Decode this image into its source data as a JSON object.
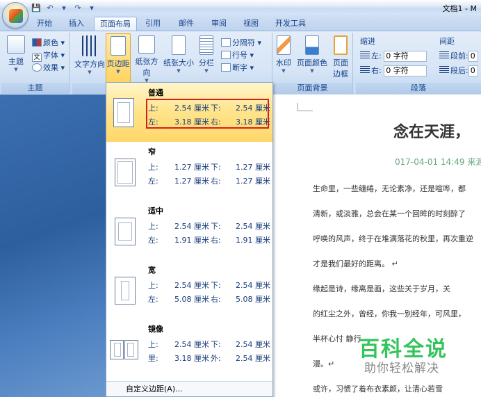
{
  "window": {
    "title": "文档1 - M"
  },
  "tabs": [
    "开始",
    "插入",
    "页面布局",
    "引用",
    "邮件",
    "审阅",
    "视图",
    "开发工具"
  ],
  "ribbon": {
    "theme_group": {
      "label": "主题",
      "theme_btn": "主题",
      "colors": "颜色",
      "fonts": "字体",
      "effects": "效果"
    },
    "page_setup": {
      "text_direction": "文字方向",
      "margins": "页边距",
      "orientation": "纸张方向",
      "size": "纸张大小",
      "columns": "分栏",
      "breaks": "分隔符",
      "line_numbers": "行号",
      "hyphenation": "断字"
    },
    "page_background": {
      "label": "页面背景",
      "watermark": "水印",
      "page_color": "页面颜色",
      "page_border_1": "页面",
      "page_border_2": "边框"
    },
    "paragraph": {
      "label": "段落",
      "indent": "缩进",
      "spacing": "间距",
      "left": "左:",
      "right": "右:",
      "left_val": "0 字符",
      "right_val": "0 字符",
      "before": "段前:",
      "after": "段后:",
      "before_val": "0",
      "after_val": "0"
    }
  },
  "margins_menu": {
    "items": [
      {
        "name": "普通",
        "r1": [
          "上:",
          "2.54 厘米",
          "下:",
          "2.54 厘米"
        ],
        "r2": [
          "左:",
          "3.18 厘米",
          "右:",
          "3.18 厘米"
        ]
      },
      {
        "name": "窄",
        "r1": [
          "上:",
          "1.27 厘米",
          "下:",
          "1.27 厘米"
        ],
        "r2": [
          "左:",
          "1.27 厘米",
          "右:",
          "1.27 厘米"
        ]
      },
      {
        "name": "适中",
        "r1": [
          "上:",
          "2.54 厘米",
          "下:",
          "2.54 厘米"
        ],
        "r2": [
          "左:",
          "1.91 厘米",
          "右:",
          "1.91 厘米"
        ]
      },
      {
        "name": "宽",
        "r1": [
          "上:",
          "2.54 厘米",
          "下:",
          "2.54 厘米"
        ],
        "r2": [
          "左:",
          "5.08 厘米",
          "右:",
          "5.08 厘米"
        ]
      },
      {
        "name": "镜像",
        "r1": [
          "上:",
          "2.54 厘米",
          "下:",
          "2.54 厘米"
        ],
        "r2": [
          "里:",
          "3.18 厘米",
          "外:",
          "2.54 厘米"
        ]
      }
    ],
    "custom": "自定义边距(A)..."
  },
  "document": {
    "title": "念在天涯，",
    "meta": "017-04-01 14:49 来源:",
    "paragraphs": [
      "生命里，一些缱绻，无论素净，还是喧哗，都",
      "清新，或淡雅，总会在某一个回眸的时刻醉了",
      "呼唤的风声，终于在堆满落花的秋里，再次重逆",
      "才是我们最好的距离。  ↵",
      "    缘起是诗，缘离是画，这些关于岁月，关",
      "的红尘之外，曾经，你我一别经年，可风里，",
      "半杯心忖                              静行",
      "漫。↵",
      "    或许，习惯了着布衣素颜，让清心若雪"
    ]
  },
  "watermark": {
    "line1": "百科全说",
    "line2": "助你轻松解决"
  }
}
